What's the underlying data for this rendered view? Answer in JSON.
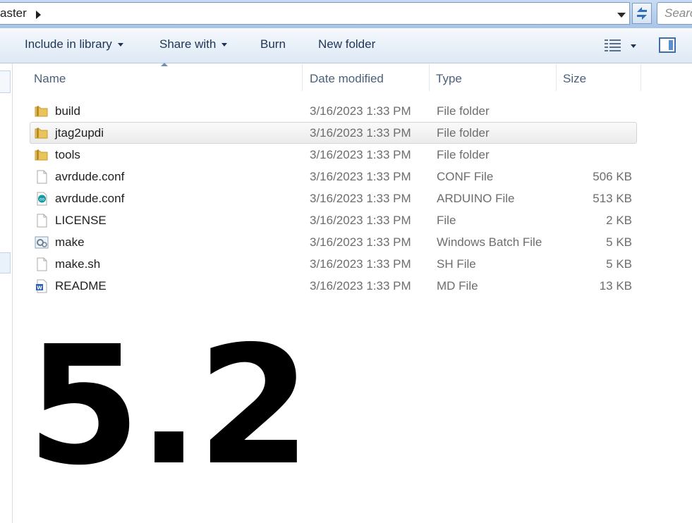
{
  "address": {
    "crumb": "aster"
  },
  "search": {
    "placeholder": "Searc"
  },
  "toolbar": {
    "include_in_library": "Include in library",
    "share_with": "Share with",
    "burn": "Burn",
    "new_folder": "New folder"
  },
  "columns": {
    "name": "Name",
    "date": "Date modified",
    "type": "Type",
    "size": "Size"
  },
  "files": [
    {
      "name": "build",
      "date": "3/16/2023 1:33 PM",
      "type": "File folder",
      "size": "",
      "icon": "folder-icon",
      "selected": false
    },
    {
      "name": "jtag2updi",
      "date": "3/16/2023 1:33 PM",
      "type": "File folder",
      "size": "",
      "icon": "folder-icon",
      "selected": true
    },
    {
      "name": "tools",
      "date": "3/16/2023 1:33 PM",
      "type": "File folder",
      "size": "",
      "icon": "folder-icon",
      "selected": false
    },
    {
      "name": "avrdude.conf",
      "date": "3/16/2023 1:33 PM",
      "type": "CONF File",
      "size": "506 KB",
      "icon": "file-icon",
      "selected": false
    },
    {
      "name": "avrdude.conf",
      "date": "3/16/2023 1:33 PM",
      "type": "ARDUINO File",
      "size": "513 KB",
      "icon": "arduino-icon",
      "selected": false
    },
    {
      "name": "LICENSE",
      "date": "3/16/2023 1:33 PM",
      "type": "File",
      "size": "2 KB",
      "icon": "file-icon",
      "selected": false
    },
    {
      "name": "make",
      "date": "3/16/2023 1:33 PM",
      "type": "Windows Batch File",
      "size": "5 KB",
      "icon": "batch-icon",
      "selected": false
    },
    {
      "name": "make.sh",
      "date": "3/16/2023 1:33 PM",
      "type": "SH File",
      "size": "5 KB",
      "icon": "file-icon",
      "selected": false
    },
    {
      "name": "README",
      "date": "3/16/2023 1:33 PM",
      "type": "MD File",
      "size": "13 KB",
      "icon": "word-doc-icon",
      "selected": false
    }
  ],
  "overlay": {
    "number": "5.2"
  },
  "colors": {
    "accent": "#3f6fa8",
    "selection": "#ebebeb",
    "folder": "#e9c45a"
  }
}
